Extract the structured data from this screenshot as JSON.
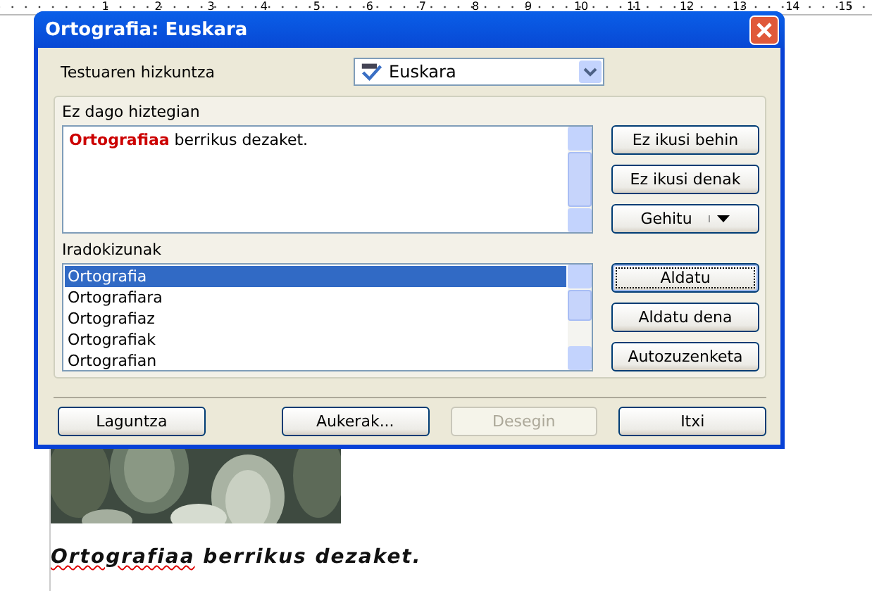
{
  "ruler": {
    "labels": [
      "1",
      "2",
      "3",
      "4",
      "5",
      "6",
      "7",
      "8",
      "9",
      "10",
      "11",
      "12",
      "13",
      "14",
      "15"
    ]
  },
  "document": {
    "words": [
      {
        "text": "Ortografiaa",
        "misspelled": true
      },
      {
        "text": "berrikus",
        "misspelled": false
      },
      {
        "text": "dezaket.",
        "misspelled": false
      }
    ]
  },
  "dialog": {
    "title": "Ortografia: Euskara",
    "language": {
      "label": "Testuaren hizkuntza",
      "value": "Euskara"
    },
    "not_in_dictionary": {
      "label": "Ez dago hiztegian",
      "text": "**Ortografiaa** berrikus dezaket."
    },
    "top_buttons": [
      {
        "label": "Ez ikusi behin",
        "kind": "plain"
      },
      {
        "label": "Ez ikusi denak",
        "kind": "plain"
      },
      {
        "label": "Gehitu",
        "kind": "split"
      }
    ],
    "suggestions": {
      "label": "Iradokizunak",
      "items": [
        {
          "text": "Ortografia",
          "selected": true
        },
        {
          "text": "Ortografiara",
          "selected": false
        },
        {
          "text": "Ortografiaz",
          "selected": false
        },
        {
          "text": "Ortografiak",
          "selected": false
        },
        {
          "text": "Ortografian",
          "selected": false
        }
      ]
    },
    "lower_buttons": [
      {
        "label": "Aldatu",
        "kind": "default"
      },
      {
        "label": "Aldatu dena",
        "kind": "plain"
      },
      {
        "label": "Autozuzenketa",
        "kind": "plain"
      }
    ],
    "bottom_buttons": [
      {
        "label": "Laguntza",
        "disabled": false
      },
      {
        "label": "Aukerak...",
        "disabled": false
      },
      {
        "label": "Desegin",
        "disabled": true
      },
      {
        "label": "Itxi",
        "disabled": false
      }
    ]
  }
}
